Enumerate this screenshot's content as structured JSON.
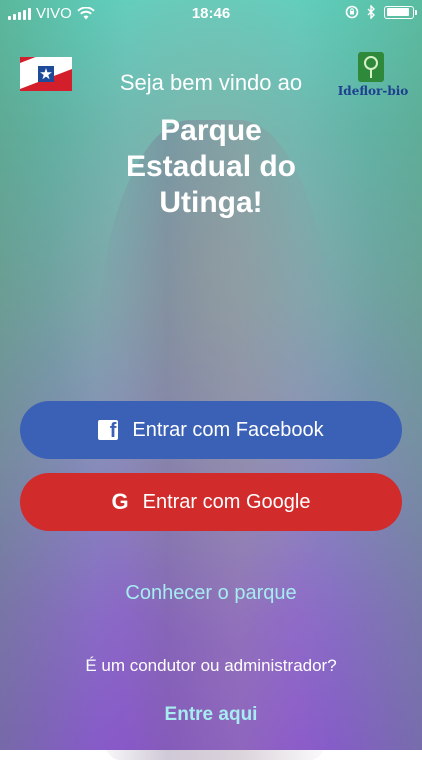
{
  "status_bar": {
    "carrier": "VIVO",
    "time": "18:46",
    "battery_fraction": 0.9
  },
  "header": {
    "flag_icon": "para-state-flag-icon",
    "logo_text": "Ideflor-bio",
    "welcome": "Seja bem vindo ao",
    "title_lines": [
      "Parque",
      "Estadual do",
      "Utinga!"
    ]
  },
  "buttons": {
    "facebook_label": "Entrar com Facebook",
    "google_label": "Entrar com Google",
    "facebook_color": "#3b61b7",
    "google_color": "#d22b2b"
  },
  "links": {
    "know_park": "Conhecer o parque",
    "question": "É um condutor ou administrador?",
    "enter_here": "Entre aqui",
    "link_color": "#a6ecf0"
  }
}
